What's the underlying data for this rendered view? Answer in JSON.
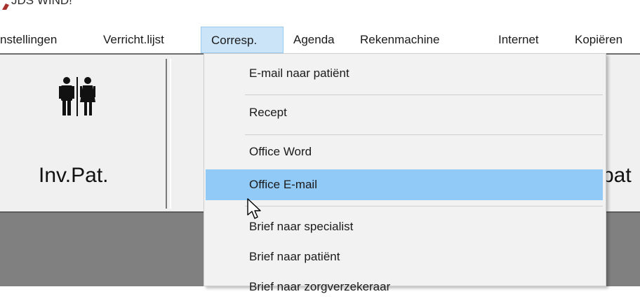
{
  "window": {
    "title": "JDS WIND!"
  },
  "menubar": {
    "items": [
      {
        "label": "nstellingen"
      },
      {
        "label": "Verricht.lijst"
      },
      {
        "label": "Corresp."
      },
      {
        "label": "Agenda"
      },
      {
        "label": "Rekenmachine"
      },
      {
        "label": "Internet"
      },
      {
        "label": "Kopiëren"
      }
    ],
    "open_item": "Corresp."
  },
  "toolbar": {
    "left_button": {
      "label": "Inv.Pat.",
      "icon": "male-female-icon"
    },
    "right_button": {
      "label": "pat"
    }
  },
  "dropdown": {
    "items": [
      {
        "label": "E-mail naar patiënt"
      },
      {
        "label": "Recept"
      },
      {
        "label": "Office Word"
      },
      {
        "label": "Office E-mail"
      },
      {
        "label": "Brief naar specialist"
      },
      {
        "label": "Brief naar patiënt"
      },
      {
        "label": "Brief naar zorgverzekeraar"
      }
    ],
    "highlighted": "Office E-mail"
  },
  "colors": {
    "menu_open_bg": "#cce4f7",
    "highlight_bg": "#91c9f7",
    "toolbar_bg": "#f0f0f0",
    "workspace_bg": "#808080"
  }
}
